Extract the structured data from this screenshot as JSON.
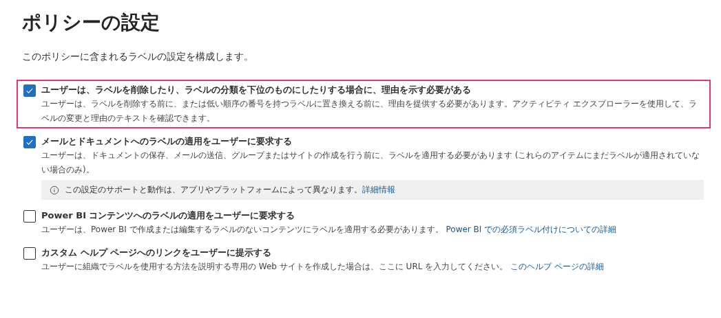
{
  "title": "ポリシーの設定",
  "subtitle": "このポリシーに含まれるラベルの設定を構成します。",
  "options": [
    {
      "label": "ユーザーは、ラベルを削除したり、ラベルの分類を下位のものにしたりする場合に、理由を示す必要がある",
      "checked": true,
      "highlighted": true,
      "description": "ユーザーは、ラベルを削除する前に、または低い順序の番号を持つラベルに置き換える前に、理由を提供する必要があります。アクティビティ エクスプローラーを使用して、ラベルの変更と理由のテキストを確認できます。"
    },
    {
      "label": "メールとドキュメントへのラベルの適用をユーザーに要求する",
      "checked": true,
      "highlighted": false,
      "description": "ユーザーは、ドキュメントの保存、メールの送信、グループまたはサイトの作成を行う前に、ラベルを適用する必要があります (これらのアイテムにまだラベルが適用されていない場合のみ)。",
      "note": {
        "text": "この設定のサポートと動作は、アプリやプラットフォームによって異なります。",
        "link": "詳細情報"
      }
    },
    {
      "label": "Power BI コンテンツへのラベルの適用をユーザーに要求する",
      "checked": false,
      "highlighted": false,
      "description": "ユーザーは、Power BI で作成または編集するラベルのないコンテンツにラベルを適用する必要があります。",
      "link": "Power BI での必須ラベル付けについての詳細"
    },
    {
      "label": "カスタム ヘルプ ページへのリンクをユーザーに提示する",
      "checked": false,
      "highlighted": false,
      "description": "ユーザーに組織でラベルを使用する方法を説明する専用の Web サイトを作成した場合は、ここに URL を入力してください。",
      "link": "このヘルプ ページの詳細"
    }
  ]
}
